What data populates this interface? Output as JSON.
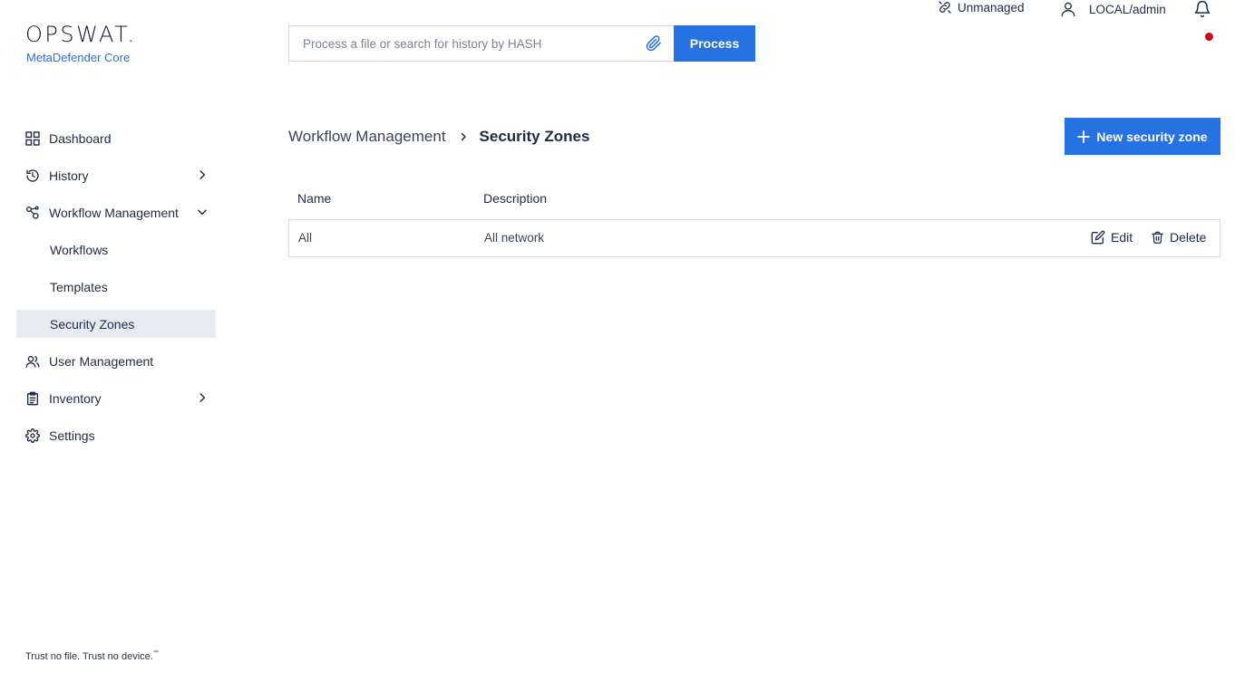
{
  "brand": {
    "logo_text": "OPSWAT.",
    "product": "MetaDefender Core",
    "tagline": "Trust no file. Trust no device.",
    "tagline_mark": "™"
  },
  "search": {
    "placeholder": "Process a file or search for history by HASH",
    "value": "",
    "icon": "paperclip-icon",
    "button_label": "Process"
  },
  "topbar": {
    "managed_status": "Unmanaged",
    "user": "LOCAL/admin",
    "notifications_unread": true
  },
  "sidebar": {
    "items": [
      {
        "label": "Dashboard",
        "icon": "grid-icon"
      },
      {
        "label": "History",
        "icon": "history-icon",
        "expandable": true
      },
      {
        "label": "Workflow Management",
        "icon": "workflow-icon",
        "expanded": true,
        "children": [
          {
            "label": "Workflows"
          },
          {
            "label": "Templates"
          },
          {
            "label": "Security Zones",
            "active": true
          }
        ]
      },
      {
        "label": "User Management",
        "icon": "users-icon"
      },
      {
        "label": "Inventory",
        "icon": "clipboard-icon",
        "expandable": true
      },
      {
        "label": "Settings",
        "icon": "gear-icon"
      }
    ]
  },
  "breadcrumb": {
    "parent": "Workflow Management",
    "current": "Security Zones"
  },
  "actions": {
    "new_button": "New security zone"
  },
  "table": {
    "columns": [
      "Name",
      "Description"
    ],
    "rows": [
      {
        "name": "All",
        "description": "All network",
        "edit_label": "Edit",
        "delete_label": "Delete"
      }
    ]
  },
  "colors": {
    "accent": "#2672e3",
    "brand_sub": "#2d6fd6",
    "active_nav_bg": "#e9ebf2",
    "notification_dot": "#d0021b"
  }
}
